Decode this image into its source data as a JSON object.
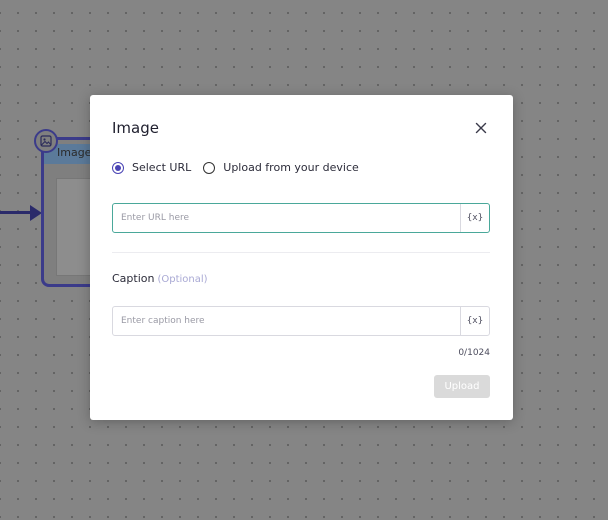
{
  "background_node": {
    "title": "Image"
  },
  "modal": {
    "title": "Image",
    "source_options": [
      {
        "label": "Select URL",
        "checked": true
      },
      {
        "label": "Upload from your device",
        "checked": false
      }
    ],
    "url_field": {
      "placeholder": "Enter URL here",
      "value": "",
      "variable_button": "{x}"
    },
    "caption": {
      "label": "Caption",
      "optional_text": "(Optional)",
      "placeholder": "Enter caption here",
      "value": "",
      "variable_button": "{x}",
      "counter": "0/1024"
    },
    "upload_button": "Upload"
  },
  "colors": {
    "accent": "#4a44b5",
    "focus_border": "#4aa89a",
    "disabled_button": "#dadada"
  }
}
